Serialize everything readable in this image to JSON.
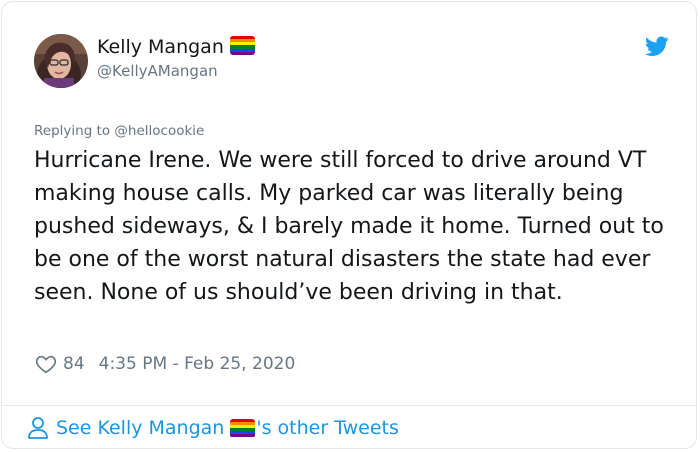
{
  "tweet": {
    "author_name": "Kelly Mangan",
    "author_handle": "@KellyAMangan",
    "flag_icon": "rainbow-flag-icon",
    "reply_prefix": "Replying to",
    "reply_to": "@hellocookie",
    "text": "Hurricane Irene. We were still forced to drive around VT making house calls. My parked car was literally being pushed sideways, & I barely made it home. Turned out to be one of the worst natural disasters the state had ever seen. None of us should’ve been driving in that.",
    "likes": "84",
    "timestamp": "4:35 PM - Feb 25, 2020"
  },
  "footer": {
    "see_prefix": "See Kelly Mangan",
    "see_suffix": "'s other Tweets"
  },
  "colors": {
    "twitter_blue": "#1da1f2",
    "link_blue": "#1b95e0",
    "muted": "#657786",
    "border": "#e1e8ed",
    "rainbow": [
      "#e40303",
      "#ff8c00",
      "#ffed00",
      "#008026",
      "#004dff",
      "#750787"
    ]
  }
}
